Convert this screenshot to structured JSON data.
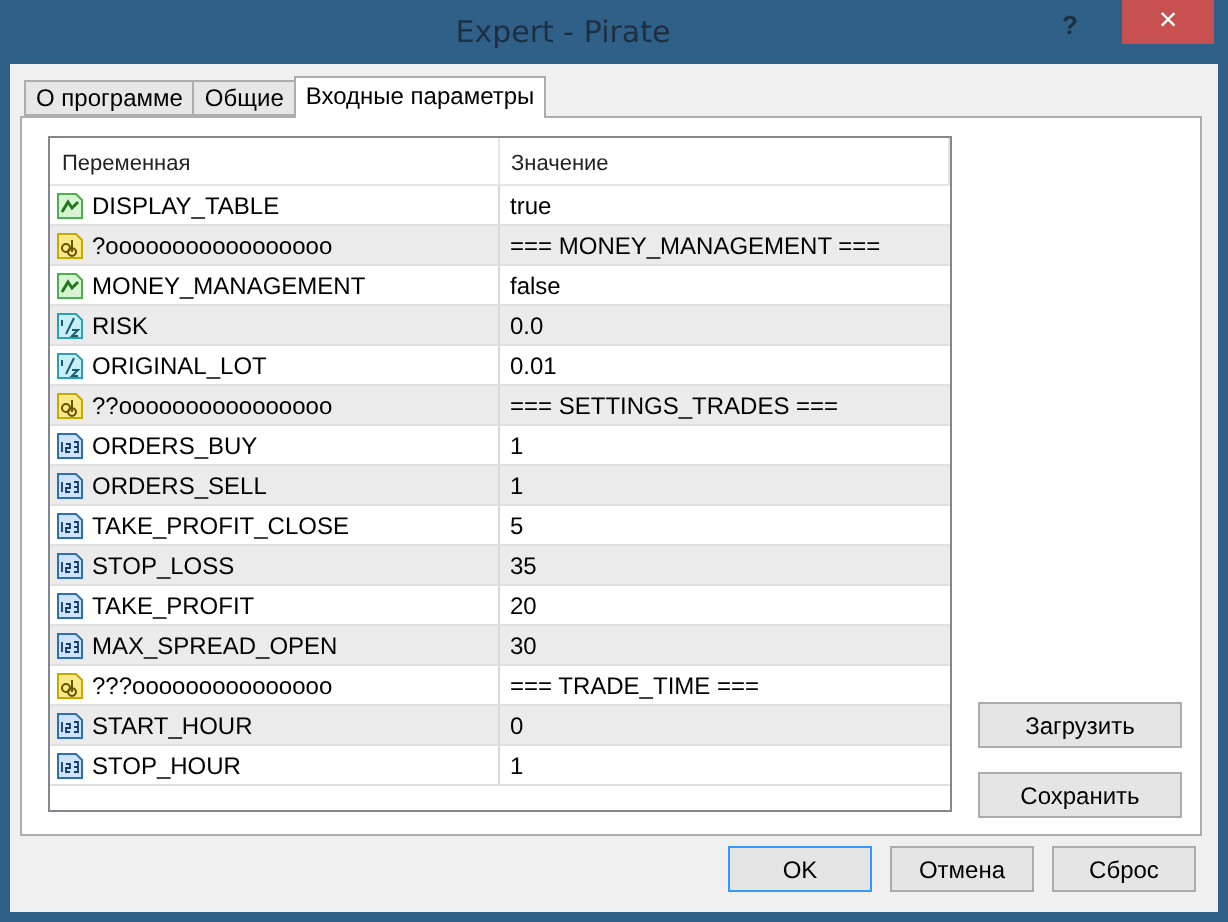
{
  "window": {
    "title": "Expert - Pirate",
    "help": "?",
    "close": "×"
  },
  "tabs": [
    {
      "label": "О программе",
      "selected": false
    },
    {
      "label": "Общие",
      "selected": false
    },
    {
      "label": "Входные параметры",
      "selected": true
    }
  ],
  "table": {
    "columns": [
      "Переменная",
      "Значение"
    ],
    "rows": [
      {
        "kind": "bool",
        "name": "DISPLAY_TABLE",
        "value": "true"
      },
      {
        "kind": "string",
        "name": "?ooooooooooooooooo",
        "value": "=== MONEY_MANAGEMENT ==="
      },
      {
        "kind": "bool",
        "name": "MONEY_MANAGEMENT",
        "value": "false"
      },
      {
        "kind": "double",
        "name": "RISK",
        "value": "0.0"
      },
      {
        "kind": "double",
        "name": "ORIGINAL_LOT",
        "value": "0.01"
      },
      {
        "kind": "string",
        "name": "??oooooooooooooooo",
        "value": "=== SETTINGS_TRADES ==="
      },
      {
        "kind": "int",
        "name": "ORDERS_BUY",
        "value": "1"
      },
      {
        "kind": "int",
        "name": "ORDERS_SELL",
        "value": "1"
      },
      {
        "kind": "int",
        "name": "TAKE_PROFIT_CLOSE",
        "value": "5"
      },
      {
        "kind": "int",
        "name": "STOP_LOSS",
        "value": "35"
      },
      {
        "kind": "int",
        "name": "TAKE_PROFIT",
        "value": "20"
      },
      {
        "kind": "int",
        "name": "MAX_SPREAD_OPEN",
        "value": "30"
      },
      {
        "kind": "string",
        "name": "???ooooooooooooooo",
        "value": "=== TRADE_TIME ==="
      },
      {
        "kind": "int",
        "name": "START_HOUR",
        "value": "0"
      },
      {
        "kind": "int",
        "name": "STOP_HOUR",
        "value": "1"
      }
    ]
  },
  "side_buttons": [
    "Загрузить",
    "Сохранить"
  ],
  "buttons": [
    {
      "label": "OK",
      "default": true
    },
    {
      "label": "Отмена",
      "default": false
    },
    {
      "label": "Сброс",
      "default": false
    }
  ]
}
